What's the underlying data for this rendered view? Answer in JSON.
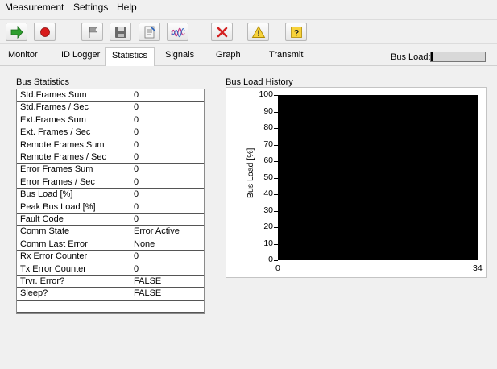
{
  "menu": {
    "items": [
      {
        "label": "Measurement"
      },
      {
        "label": "Settings"
      },
      {
        "label": "Help"
      }
    ]
  },
  "toolbar": {
    "buttons": [
      {
        "name": "start-button",
        "icon": "arrow-right-icon",
        "color": "#2e9e2e"
      },
      {
        "name": "stop-button",
        "icon": "record-stop-icon",
        "color": "#d81b1b"
      },
      {
        "name": "flag-button",
        "icon": "flag-icon",
        "color": "#888888"
      },
      {
        "name": "save-button",
        "icon": "floppy-disk-icon",
        "color": "#555555"
      },
      {
        "name": "export-button",
        "icon": "document-edit-icon",
        "color": "#666666"
      },
      {
        "name": "waveform-button",
        "icon": "waveform-icon",
        "color": "#c03080"
      },
      {
        "name": "clear-button",
        "icon": "red-x-icon",
        "color": "#d42020"
      },
      {
        "name": "warning-button",
        "icon": "warning-triangle-icon",
        "color": "#f2c200"
      },
      {
        "name": "help-button",
        "icon": "question-mark-icon",
        "color": "#f2c200"
      }
    ]
  },
  "tabs": {
    "items": [
      {
        "label": "Monitor"
      },
      {
        "label": "ID Logger"
      },
      {
        "label": "Statistics",
        "active": true
      },
      {
        "label": "Signals"
      },
      {
        "label": "Graph"
      },
      {
        "label": "Transmit"
      }
    ],
    "bus_load_label": "Bus Load:",
    "bus_load_fraction": 0.03
  },
  "bus_statistics": {
    "title": "Bus Statistics",
    "rows": [
      {
        "name": "Std.Frames Sum",
        "value": "0"
      },
      {
        "name": "Std.Frames / Sec",
        "value": "0"
      },
      {
        "name": "Ext.Frames Sum",
        "value": "0"
      },
      {
        "name": "Ext. Frames / Sec",
        "value": "0"
      },
      {
        "name": "Remote Frames Sum",
        "value": "0"
      },
      {
        "name": "Remote Frames / Sec",
        "value": "0"
      },
      {
        "name": "Error Frames Sum",
        "value": "0"
      },
      {
        "name": "Error Frames / Sec",
        "value": "0"
      },
      {
        "name": "Bus Load [%]",
        "value": "0"
      },
      {
        "name": "Peak Bus Load [%]",
        "value": "0"
      },
      {
        "name": "Fault Code",
        "value": "0"
      },
      {
        "name": "Comm State",
        "value": "Error Active"
      },
      {
        "name": "Comm Last Error",
        "value": "None"
      },
      {
        "name": "Rx Error Counter",
        "value": "0"
      },
      {
        "name": "Tx Error Counter",
        "value": "0"
      },
      {
        "name": "Trvr. Error?",
        "value": "FALSE"
      },
      {
        "name": "Sleep?",
        "value": "FALSE"
      },
      {
        "name": "",
        "value": ""
      }
    ]
  },
  "bus_load_history": {
    "title": "Bus Load History",
    "ylabel": "Bus Load [%]",
    "yticks": [
      "100",
      "90",
      "80",
      "70",
      "60",
      "50",
      "40",
      "30",
      "20",
      "10",
      "0"
    ],
    "xticks": [
      "0",
      "34"
    ]
  },
  "chart_data": {
    "type": "line",
    "title": "Bus Load History",
    "xlabel": "",
    "ylabel": "Bus Load [%]",
    "xlim": [
      0,
      34
    ],
    "ylim": [
      0,
      100
    ],
    "series": [],
    "background": "#000000",
    "grid": false
  }
}
